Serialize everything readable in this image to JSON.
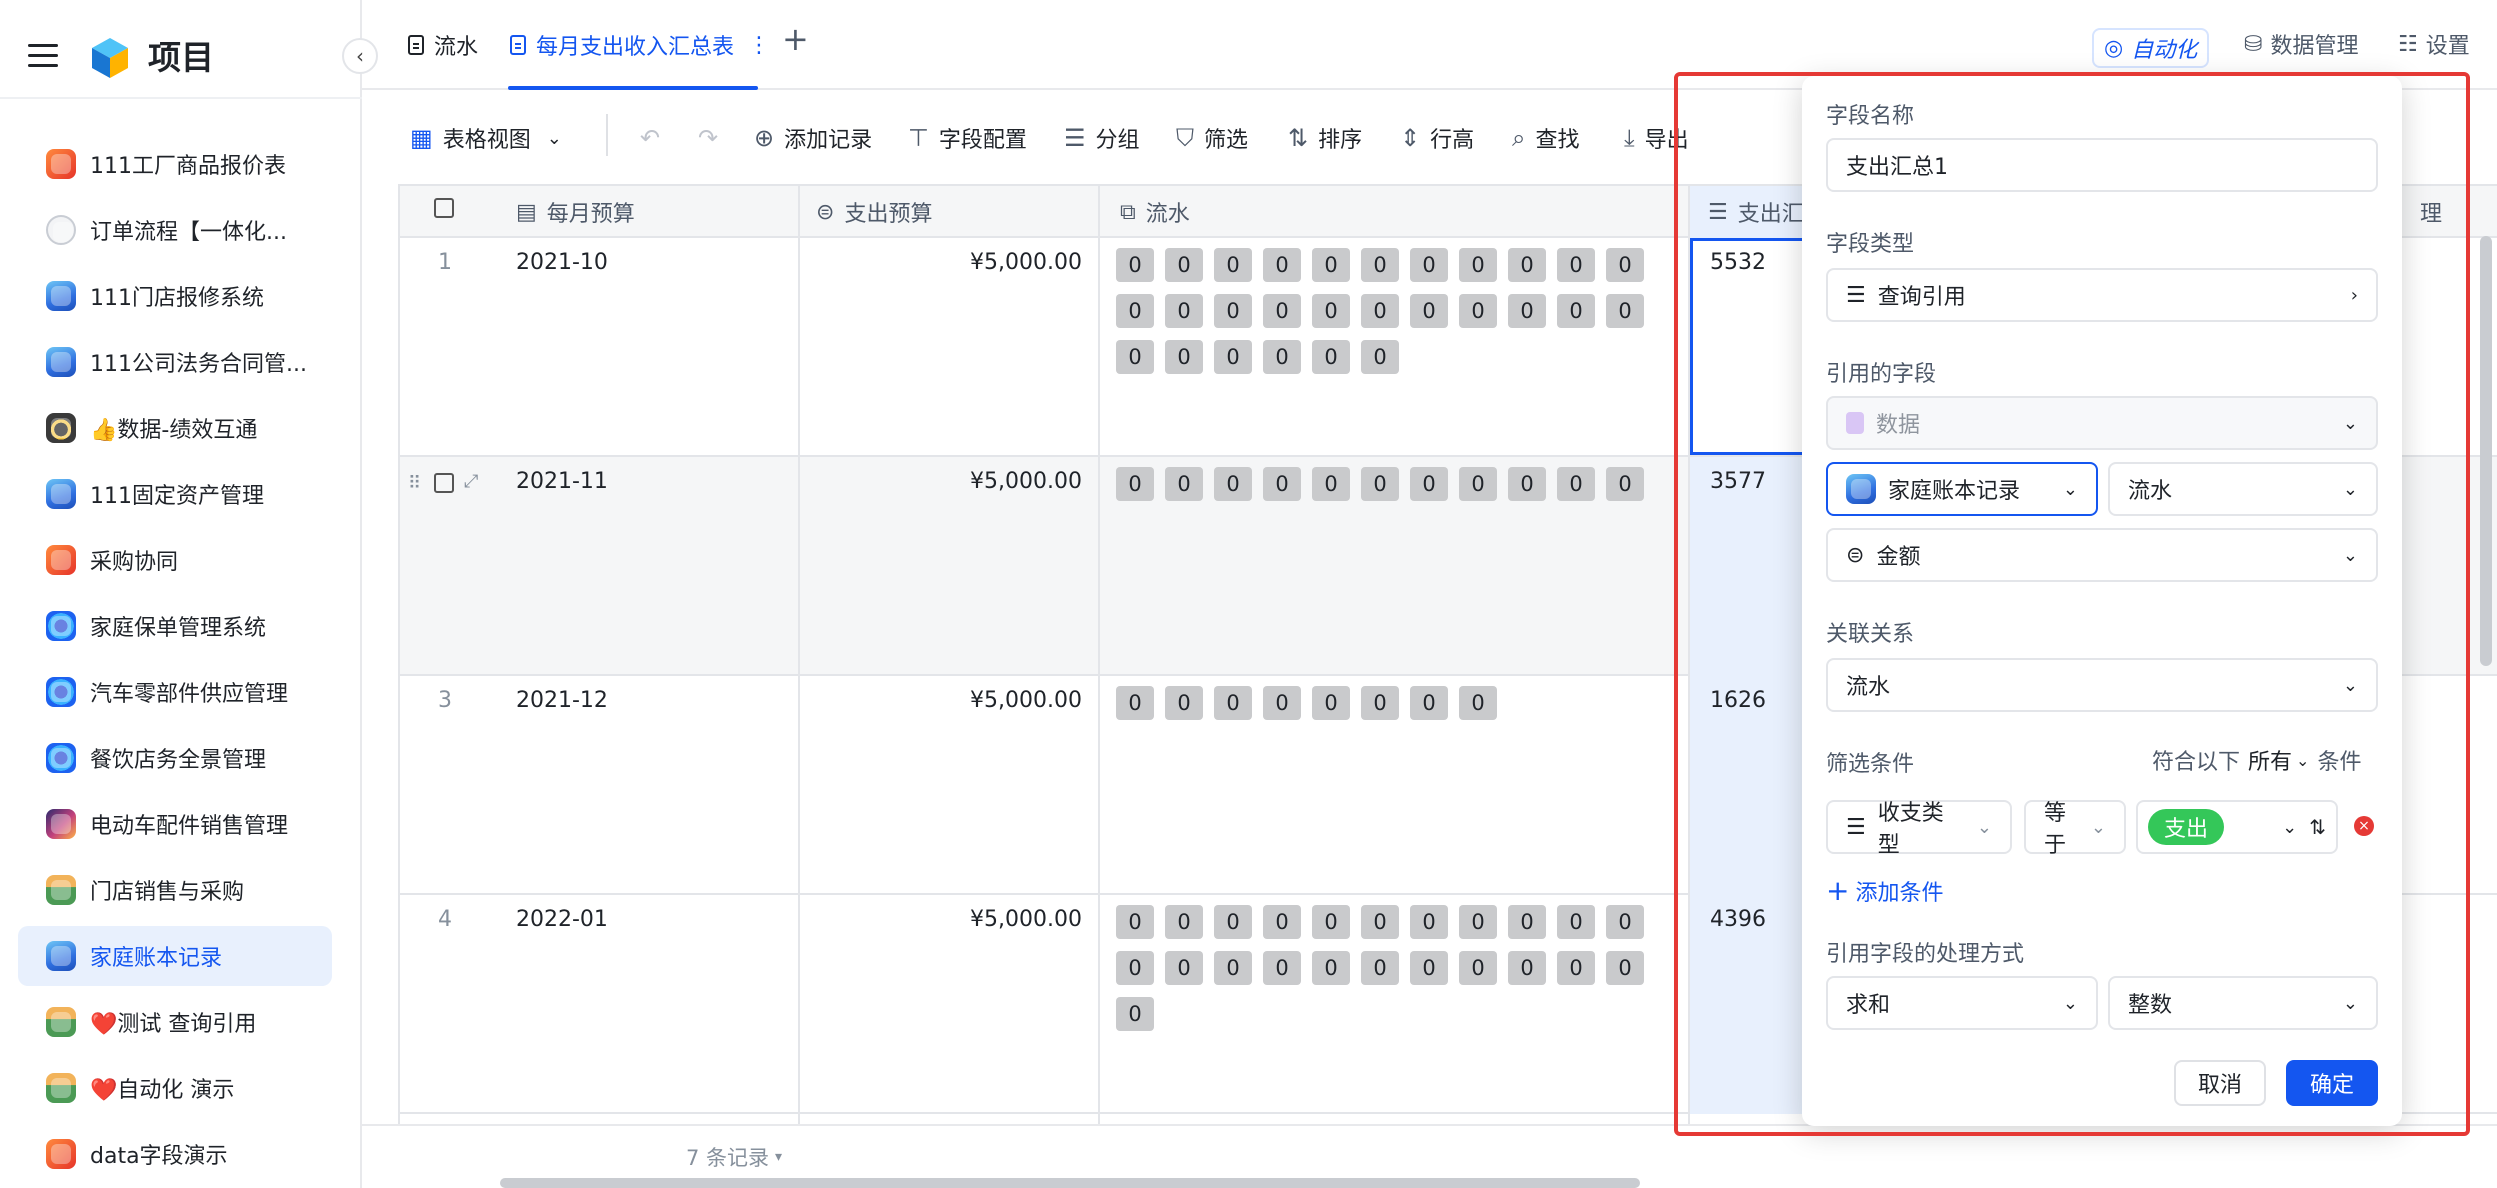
{
  "app": {
    "name": "项目"
  },
  "sidebar": {
    "items": [
      {
        "label": "111工厂商品报价表",
        "icon": "red-app-icon",
        "color": "red"
      },
      {
        "label": "订单流程【一体化...",
        "icon": "flow-app-icon",
        "color": "flow"
      },
      {
        "label": "111门店报修系统",
        "icon": "blue-app-icon",
        "color": "blue"
      },
      {
        "label": "111公司法务合同管...",
        "icon": "blue-app-icon",
        "color": "blue"
      },
      {
        "label": "👍数据-绩效互通",
        "icon": "dark-app-icon",
        "color": "dark"
      },
      {
        "label": "111固定资产管理",
        "icon": "blue-app-icon",
        "color": "blue"
      },
      {
        "label": "采购协同",
        "icon": "red-app-icon",
        "color": "red"
      },
      {
        "label": "家庭保单管理系统",
        "icon": "target-app-icon",
        "color": "target"
      },
      {
        "label": "汽车零部件供应管理",
        "icon": "target-app-icon",
        "color": "target"
      },
      {
        "label": "餐饮店务全景管理",
        "icon": "target-app-icon",
        "color": "target"
      },
      {
        "label": "电动车配件销售管理",
        "icon": "ev-app-icon",
        "color": "ev"
      },
      {
        "label": "门店销售与采购",
        "icon": "landscape-app-icon",
        "color": "land"
      },
      {
        "label": "家庭账本记录",
        "icon": "blue-app-icon",
        "color": "blue",
        "active": true
      },
      {
        "label": "❤️测试 查询引用",
        "icon": "landscape-app-icon",
        "color": "land"
      },
      {
        "label": "❤️自动化 演示",
        "icon": "landscape-app-icon",
        "color": "land"
      },
      {
        "label": "data字段演示",
        "icon": "red-app-icon",
        "color": "red"
      }
    ]
  },
  "tabs": {
    "items": [
      {
        "label": "流水"
      },
      {
        "label": "每月支出收入汇总表",
        "active": true
      }
    ],
    "add": "+",
    "more": "⋮"
  },
  "top_right": {
    "automation": "自动化",
    "data_manage": "数据管理",
    "settings": "设置"
  },
  "toolbar": {
    "view": "表格视图",
    "add_record": "添加记录",
    "field_config": "字段配置",
    "group": "分组",
    "filter": "筛选",
    "sort": "排序",
    "row_height": "行高",
    "search": "查找",
    "export": "导出"
  },
  "grid": {
    "headers": {
      "month": "每月预算",
      "budget": "支出预算",
      "flow": "流水",
      "summary": "支出汇",
      "right_partial": "理"
    },
    "rows": [
      {
        "num": "1",
        "month": "2021-10",
        "budget": "¥5,000.00",
        "chips": 28,
        "summary": "5532"
      },
      {
        "num": "",
        "month": "2021-11",
        "budget": "¥5,000.00",
        "chips": 11,
        "summary": "3577"
      },
      {
        "num": "3",
        "month": "2021-12",
        "budget": "¥5,000.00",
        "chips": 8,
        "summary": "1626"
      },
      {
        "num": "4",
        "month": "2022-01",
        "budget": "¥5,000.00",
        "chips": 23,
        "summary": "4396"
      }
    ],
    "chip_value": "0"
  },
  "footer": {
    "count": "7 条记录"
  },
  "panel": {
    "field_name_label": "字段名称",
    "field_name_value": "支出汇总1",
    "field_type_label": "字段类型",
    "field_type_value": "查询引用",
    "ref_field_label": "引用的字段",
    "ref_source": "数据",
    "ref_table": "家庭账本记录",
    "ref_sheet": "流水",
    "ref_column": "金额",
    "relation_label": "关联关系",
    "relation_value": "流水",
    "filter_label": "筛选条件",
    "match_prefix": "符合以下",
    "match_mode": "所有",
    "match_suffix": "条件",
    "cond_field": "收支类型",
    "cond_op": "等于",
    "cond_value": "支出",
    "add_condition": "添加条件",
    "process_label": "引用字段的处理方式",
    "process_agg": "求和",
    "process_format": "整数",
    "cancel": "取消",
    "confirm": "确定"
  },
  "colors": {
    "accent": "#1456f0",
    "highlight": "#e53935",
    "tag_green": "#34c759"
  }
}
